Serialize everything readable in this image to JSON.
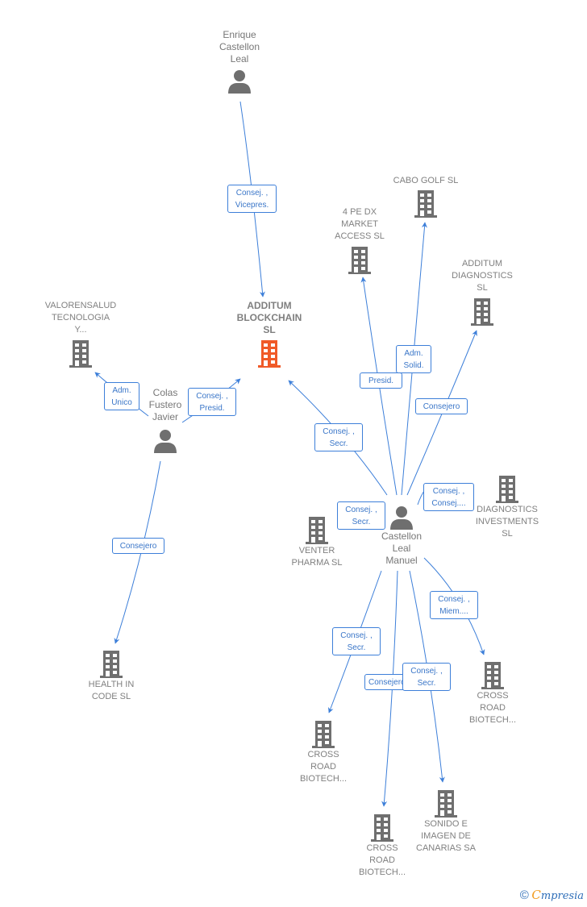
{
  "colors": {
    "edge": "#3d7fd9",
    "main_company": "#f05a28",
    "company": "#6f6f6f",
    "person": "#6f6f6f"
  },
  "nodes": {
    "enrique": {
      "label": "Enrique\nCastellon\nLeal",
      "type": "person"
    },
    "additum_blockchain": {
      "label": "ADDITUM\nBLOCKCHAIN\nSL",
      "type": "main-company"
    },
    "valorensalud": {
      "label": "VALORENSALUD\nTECNOLOGIA\nY...",
      "type": "company"
    },
    "colas": {
      "label": "Colas\nFustero\nJavier",
      "type": "person"
    },
    "health_in_code": {
      "label": "HEALTH IN\nCODE  SL",
      "type": "company"
    },
    "cabo_golf": {
      "label": "CABO GOLF SL",
      "type": "company"
    },
    "pe_dx": {
      "label": "4 PE DX\nMARKET\nACCESS  SL",
      "type": "company"
    },
    "additum_diagnostics": {
      "label": "ADDITUM\nDIAGNOSTICS\nSL",
      "type": "company"
    },
    "diagnostics_investments": {
      "label": "DIAGNOSTICS\nINVESTMENTS\nSL",
      "type": "company"
    },
    "venter_pharma": {
      "label": "VENTER\nPHARMA SL",
      "type": "company"
    },
    "castellon_manuel": {
      "label": "Castellon\nLeal\nManuel",
      "type": "person"
    },
    "cross_road_1": {
      "label": "CROSS\nROAD\nBIOTECH...",
      "type": "company"
    },
    "cross_road_2": {
      "label": "CROSS\nROAD\nBIOTECH...",
      "type": "company"
    },
    "cross_road_3": {
      "label": "CROSS\nROAD\nBIOTECH...",
      "type": "company"
    },
    "sonido_imagen": {
      "label": "SONIDO E\nIMAGEN DE\nCANARIAS SA",
      "type": "company"
    }
  },
  "edges": [
    {
      "from": "enrique",
      "to": "additum_blockchain",
      "label": "Consej. ,\nVicepres."
    },
    {
      "from": "colas",
      "to": "valorensalud",
      "label": "Adm.\nUnico"
    },
    {
      "from": "colas",
      "to": "additum_blockchain",
      "label": "Consej. ,\nPresid."
    },
    {
      "from": "colas",
      "to": "health_in_code",
      "label": "Consejero"
    },
    {
      "from": "castellon_manuel",
      "to": "additum_blockchain",
      "label": "Consej. ,\nSecr."
    },
    {
      "from": "castellon_manuel",
      "to": "pe_dx",
      "label": "Presid."
    },
    {
      "from": "castellon_manuel",
      "to": "cabo_golf",
      "label": "Adm.\nSolid."
    },
    {
      "from": "castellon_manuel",
      "to": "additum_diagnostics",
      "label": "Consejero"
    },
    {
      "from": "castellon_manuel",
      "to": "diagnostics_investments",
      "label": "Consej. ,\nConsej...."
    },
    {
      "from": "castellon_manuel",
      "to": "venter_pharma",
      "label": "Consej. ,\nSecr."
    },
    {
      "from": "castellon_manuel",
      "to": "cross_road_3",
      "label": "Consej. ,\nMiem...."
    },
    {
      "from": "castellon_manuel",
      "to": "cross_road_1",
      "label": "Consej. ,\nSecr."
    },
    {
      "from": "castellon_manuel",
      "to": "cross_road_2",
      "label": "Consejero"
    },
    {
      "from": "castellon_manuel",
      "to": "sonido_imagen",
      "label": "Consej. ,\nSecr."
    }
  ],
  "brand": {
    "copyright": "©",
    "initial": "C",
    "name": "mpresia"
  }
}
